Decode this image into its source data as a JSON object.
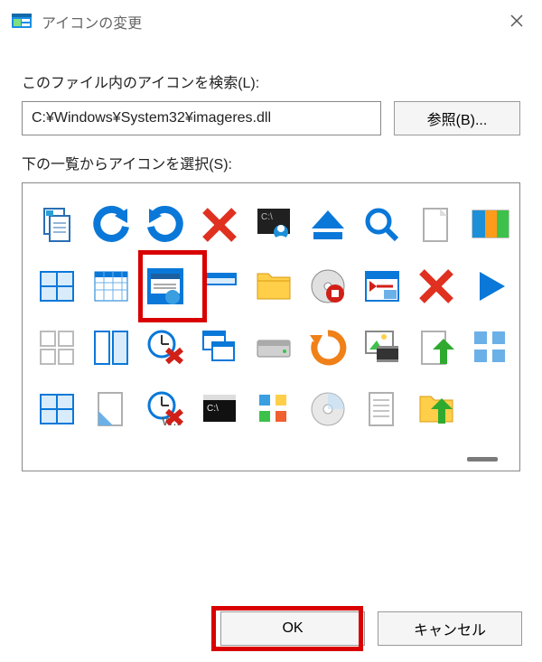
{
  "dialog": {
    "title": "アイコンの変更",
    "search_label": "このファイル内のアイコンを検索(L):",
    "path_value": "C:¥Windows¥System32¥imageres.dll",
    "browse_label": "参照(B)...",
    "select_label": "下の一覧からアイコンを選択(S):",
    "ok_label": "OK",
    "cancel_label": "キャンセル"
  },
  "highlights": {
    "selected_icon": {
      "row": 1,
      "col": 2
    },
    "ok_button": true
  },
  "icons": [
    [
      "copy-document-icon",
      "undo-icon",
      "redo-icon",
      "delete-x-red-icon",
      "cmd-user-icon",
      "eject-blue-icon",
      "search-magnifier-icon",
      "page-blank-icon",
      "window-color-icon"
    ],
    [
      "window-grid-blue-icon",
      "spreadsheet-icon",
      "program-window-icon",
      "window-minimized-icon",
      "folder-yellow-icon",
      "disc-stop-icon",
      "calendar-goto-icon",
      "delete-x-red-icon",
      "play-blue-icon"
    ],
    [
      "grid-empty-icon",
      "pane-split-icon",
      "clock-remove-icon",
      "windows-cascade-icon",
      "hard-drive-icon",
      "refresh-orange-icon",
      "image-film-icon",
      "page-upload-green-icon",
      "grid-move-icon"
    ],
    [
      "window-quad-icon",
      "page-corner-icon",
      "clock-warn-icon",
      "terminal-icon",
      "registry-blocks-icon",
      "disc-icon",
      "page-lines-icon",
      "folder-upload-green-icon",
      "spacer-icon"
    ]
  ]
}
